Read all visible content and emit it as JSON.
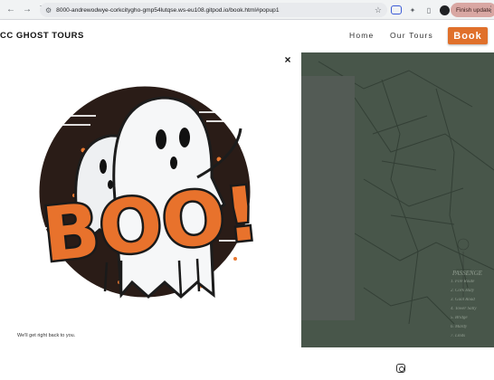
{
  "browser": {
    "url": "8000-andrewodwye-corkcitygho-gmp54lutqse.ws-eu108.gitpod.io/book.html#popup1",
    "update_label": "Finish update",
    "back_icon": "arrow-left-icon",
    "forward_icon": "arrow-right-icon",
    "reload_icon": "reload-icon"
  },
  "header": {
    "brand": "CC GHOST TOURS",
    "nav": {
      "home": "Home",
      "tours": "Our Tours"
    },
    "book_label": "Book",
    "accent_color": "#e0702b"
  },
  "popup": {
    "close_label": "×",
    "image_alt": "Boo! ghost illustration",
    "art_text": "BOO!",
    "message": "We'll get right back to you."
  },
  "background": {
    "map_legend": [
      "PASSENGE",
      "1. Fire Route",
      "2. Cork Haly",
      "3. Gaol Road",
      "4. Tower Sally",
      "5. Bridge",
      "6. Mardy",
      "7. Linds"
    ],
    "overlay_color": "#3d4a3f"
  },
  "footer": {
    "icon": "instagram-icon"
  }
}
